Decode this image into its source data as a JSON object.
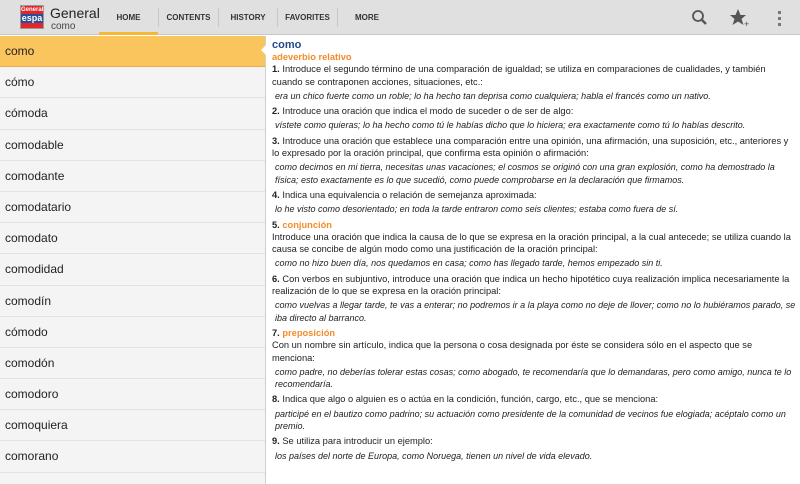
{
  "app": {
    "logo_text": "General espa",
    "title": "General",
    "subtitle": "como"
  },
  "tabs": [
    "HOME",
    "CONTENTS",
    "HISTORY",
    "FAVORITES",
    "MORE"
  ],
  "actions": [
    "search-icon",
    "star-plus-icon",
    "overflow-menu-icon"
  ],
  "list": [
    "como",
    "cómo",
    "cómoda",
    "comodable",
    "comodante",
    "comodatario",
    "comodato",
    "comodidad",
    "comodín",
    "cómodo",
    "comodón",
    "comodoro",
    "comoquiera",
    "comorano"
  ],
  "entry": {
    "headword": "como",
    "pos1": "adeverbio relativo",
    "senses": [
      {
        "n": "1.",
        "def": "Introduce el segundo término de una comparación de igualdad; se utiliza en comparaciones de cualidades, y también cuando se contraponen acciones, situaciones, etc.:",
        "ex": "era un chico fuerte como un roble; lo ha hecho tan deprisa como cualquiera; habla el francés como un nativo."
      },
      {
        "n": "2.",
        "def": "Introduce una oración que indica el modo de suceder o de ser de algo:",
        "ex": "vístete como quieras; lo ha hecho como tú le habías dicho que lo hiciera; era exactamente como tú lo habías descrito."
      },
      {
        "n": "3.",
        "def": "Introduce una oración que establece una comparación entre una opinión, una afirmación, una suposición, etc., anteriores y lo expresado por la oración principal, que confirma esta opinión o afirmación:",
        "ex": "como decimos en mi tierra, necesitas unas vacaciones; el cosmos se originó con una gran explosión, como ha demostrado la física; esto exactamente es lo que sucedió, como puede comprobarse en la declaración que firmamos."
      },
      {
        "n": "4.",
        "def": "Indica una equivalencia o relación de semejanza aproximada:",
        "ex": "lo he visto como desorientado; en toda la tarde entraron como seis clientes; estaba como fuera de sí."
      },
      {
        "n": "5.",
        "pos": "conjunción",
        "def": "Introduce una oración que indica la causa de lo que se expresa en la oración principal, a la cual antecede; se utiliza cuando la causa se concibe de algún modo como una justificación de la oración principal:",
        "ex": "como no hizo buen día, nos quedamos en casa; como has llegado tarde, hemos empezado sin ti."
      },
      {
        "n": "6.",
        "def": "Con verbos en subjuntivo, introduce una oración que indica un hecho hipotético cuya realización implica necesariamente la realización de lo que se expresa en la oración principal:",
        "ex": "como vuelvas a llegar tarde, te vas a enterar; no podremos ir a la playa como no deje de llover; como no lo hubiéramos parado, se iba directo al barranco."
      },
      {
        "n": "7.",
        "pos": "preposición",
        "def": "Con un nombre sin artículo, indica que la persona o cosa designada por éste se considera sólo en el aspecto que se menciona:",
        "ex": "como padre, no deberías tolerar estas cosas; como abogado, te recomendaría que lo demandaras, pero como amigo, nunca te lo recomendaría."
      },
      {
        "n": "8.",
        "def": "Indica que algo o alguien es o actúa en la condición, función, cargo, etc., que se menciona:",
        "ex": "participé en el bautizo como padrino; su actuación como presidente de la comunidad de vecinos fue elogiada; acéptalo como un premio."
      },
      {
        "n": "9.",
        "def": "Se utiliza para introducir un ejemplo:",
        "ex": "los países del norte de Europa, como Noruega, tienen un nivel de vida elevado."
      }
    ]
  },
  "colors": {
    "accent": "#f7b733",
    "selected_row": "#fbc55d",
    "headword": "#23498a",
    "pos": "#f28c2a"
  }
}
